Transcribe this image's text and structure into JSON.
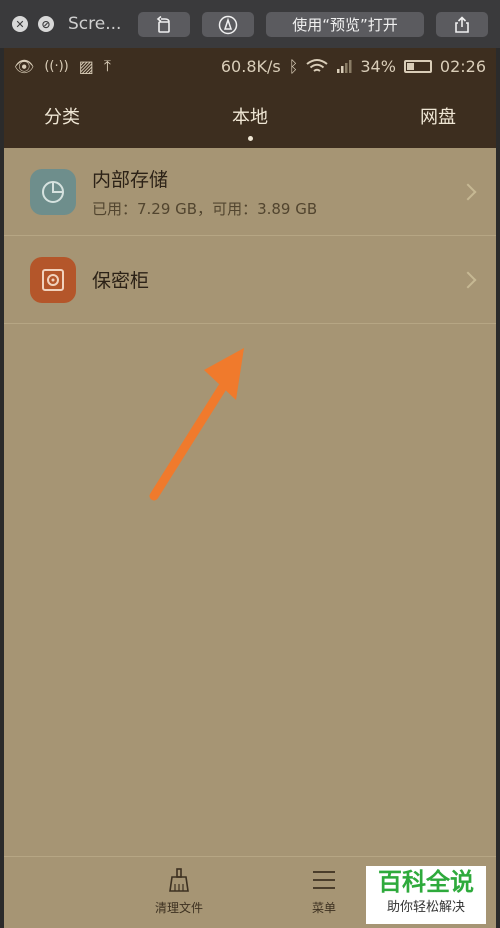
{
  "quicklook": {
    "title": "Scre...",
    "open_with_label": "使用“预览”打开"
  },
  "status": {
    "speed": "60.8K/s",
    "battery": "34%",
    "battery_level": 0.34,
    "time": "02:26"
  },
  "tabs": [
    {
      "label": "分类"
    },
    {
      "label": "本地",
      "active": true
    },
    {
      "label": "网盘"
    }
  ],
  "rows": [
    {
      "title": "内部存储",
      "subtitle": "已用：7.29 GB，可用：3.89 GB",
      "icon": "storage-pie-icon",
      "icon_color": "#6e8e8c"
    },
    {
      "title": "保密柜",
      "subtitle": "",
      "icon": "safe-icon",
      "icon_color": "#b4562a"
    }
  ],
  "bottom": {
    "clean_label": "清理文件",
    "menu_label": "菜单"
  },
  "watermark": {
    "title": "百科全说",
    "subtitle": "助你轻松解决"
  },
  "colors": {
    "background": "#a69574",
    "header": "#3d2e1f",
    "arrow": "#f07a2c"
  }
}
